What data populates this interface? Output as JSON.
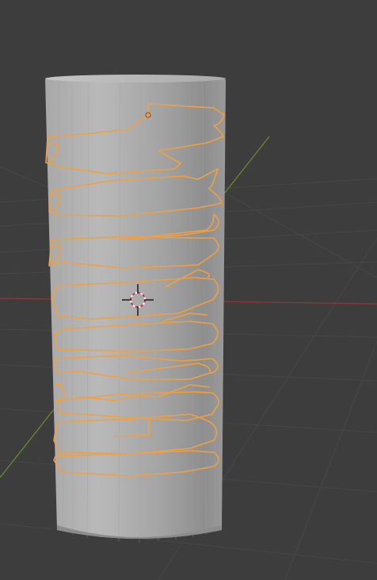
{
  "viewport": {
    "background": "#3d3d3d",
    "grid_color": "#4a4a4a",
    "x_axis_color": "#9a3b3b",
    "y_axis_color": "#6a8f2b"
  },
  "object": {
    "shape": "cylinder",
    "color_light": "#b9b9b9",
    "color_dark": "#8a8a8a",
    "selected": true
  },
  "curve": {
    "kind": "spiral-bezier-curve",
    "selected": true,
    "outline_color": "#f0a040"
  },
  "cursor": {
    "name": "3d-cursor",
    "ring_color": "#c0394b"
  }
}
